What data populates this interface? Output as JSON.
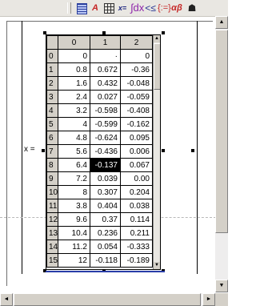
{
  "toolbar": {
    "icons": [
      "calculator-icon",
      "graph-icon",
      "matrix-icon",
      "evaluation-icon",
      "calculus-icon",
      "boolean-icon",
      "programming-icon",
      "greek-icon",
      "symbolic-icon"
    ],
    "graph_glyph": "A",
    "evaluation_glyph": "x=",
    "calculus_glyph": "∫dx",
    "boolean_glyph": "<≤",
    "programming_glyph": "{:=}",
    "greek_glyph": "αβ",
    "symbolic_glyph": "☗"
  },
  "region": {
    "label": "x ="
  },
  "matrix": {
    "columns": [
      "0",
      "1",
      "2"
    ],
    "rows": [
      {
        "index": "0",
        "c0": "0",
        "c1": "·",
        "c2": "0"
      },
      {
        "index": "1",
        "c0": "0.8",
        "c1": "0.672",
        "c2": "-0.36"
      },
      {
        "index": "2",
        "c0": "1.6",
        "c1": "0.432",
        "c2": "-0.048"
      },
      {
        "index": "3",
        "c0": "2.4",
        "c1": "0.027",
        "c2": "-0.059"
      },
      {
        "index": "4",
        "c0": "3.2",
        "c1": "-0.598",
        "c2": "-0.408"
      },
      {
        "index": "5",
        "c0": "4",
        "c1": "-0.599",
        "c2": "-0.162"
      },
      {
        "index": "6",
        "c0": "4.8",
        "c1": "-0.624",
        "c2": "0.095"
      },
      {
        "index": "7",
        "c0": "5.6",
        "c1": "-0.436",
        "c2": "0.006"
      },
      {
        "index": "8",
        "c0": "6.4",
        "c1": "-0.137",
        "c2": "0.067"
      },
      {
        "index": "9",
        "c0": "7.2",
        "c1": "0.039",
        "c2": "0.00"
      },
      {
        "index": "10",
        "c0": "8",
        "c1": "0.307",
        "c2": "0.204"
      },
      {
        "index": "11",
        "c0": "3.8",
        "c1": "0.404",
        "c2": "0.038"
      },
      {
        "index": "12",
        "c0": "9.6",
        "c1": "0.37",
        "c2": "0.114"
      },
      {
        "index": "13",
        "c0": "10.4",
        "c1": "0.236",
        "c2": "0.211"
      },
      {
        "index": "14",
        "c0": "11.2",
        "c1": "0.054",
        "c2": "-0.333"
      },
      {
        "index": "15",
        "c0": "12",
        "c1": "-0.118",
        "c2": "-0.189"
      }
    ],
    "selected_cell": {
      "row": "8",
      "column": "1"
    }
  },
  "scrollbars": {
    "up_arrow": "▲",
    "down_arrow": "▼",
    "left_arrow": "◄",
    "right_arrow": "►"
  }
}
